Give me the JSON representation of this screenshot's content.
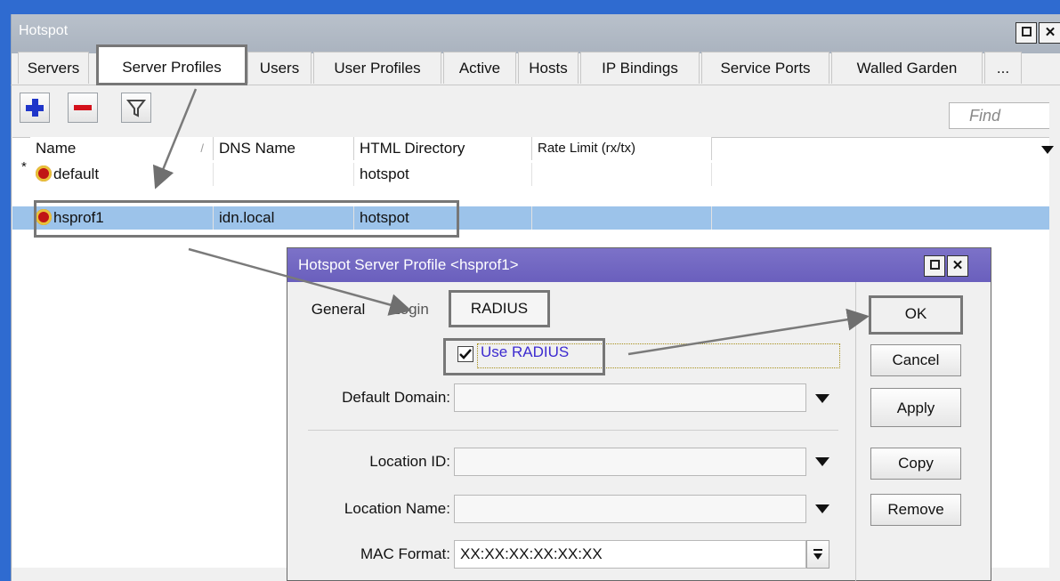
{
  "window": {
    "title": "Hotspot"
  },
  "tabs": [
    {
      "label": "Servers"
    },
    {
      "label": "Server Profiles"
    },
    {
      "label": "Users"
    },
    {
      "label": "User Profiles"
    },
    {
      "label": "Active"
    },
    {
      "label": "Hosts"
    },
    {
      "label": "IP Bindings"
    },
    {
      "label": "Service Ports"
    },
    {
      "label": "Walled Garden"
    },
    {
      "label": "..."
    }
  ],
  "toolbar": {
    "find_placeholder": "Find"
  },
  "table": {
    "columns": [
      {
        "label": "Name"
      },
      {
        "label": "DNS Name"
      },
      {
        "label": "HTML Directory"
      },
      {
        "label": "Rate Limit (rx/tx)"
      }
    ],
    "rows": [
      {
        "marker": "*",
        "name": "default",
        "dns": "",
        "html_dir": "hotspot",
        "rate": ""
      },
      {
        "marker": "",
        "name": "hsprof1",
        "dns": "idn.local",
        "html_dir": "hotspot",
        "rate": ""
      }
    ]
  },
  "dialog": {
    "title": "Hotspot Server Profile <hsprof1>",
    "tabs": [
      {
        "label": "General"
      },
      {
        "label": "Login"
      },
      {
        "label": "RADIUS"
      }
    ],
    "use_radius_label": "Use RADIUS",
    "use_radius_checked": true,
    "default_domain_label": "Default Domain:",
    "location_id_label": "Location ID:",
    "location_name_label": "Location Name:",
    "mac_format_label": "MAC Format:",
    "mac_format_value": "XX:XX:XX:XX:XX:XX",
    "buttons": {
      "ok": "OK",
      "cancel": "Cancel",
      "apply": "Apply",
      "copy": "Copy",
      "remove": "Remove"
    }
  },
  "colors": {
    "background": "#2f6bd0",
    "selection": "#9cc3ea",
    "dialog_title": "#6a5fbd",
    "highlight_border": "#777777"
  }
}
